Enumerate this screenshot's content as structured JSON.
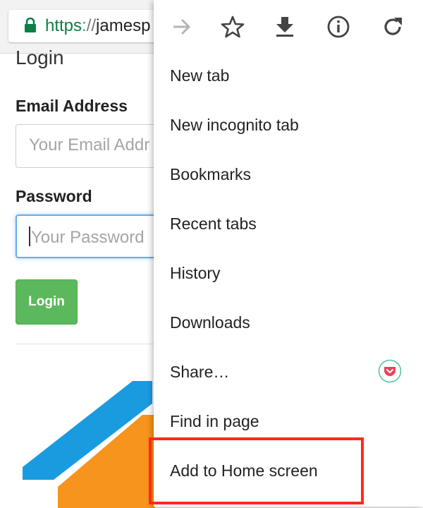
{
  "browser": {
    "url_scheme": "https",
    "url_separator": "://",
    "url_host": "jamesp",
    "icons": [
      "lock-icon",
      "forward-icon",
      "bookmark-star-icon",
      "download-icon",
      "info-icon",
      "reload-icon"
    ]
  },
  "page": {
    "title": "Login",
    "email_label": "Email Address",
    "email_placeholder": "Your Email Addr",
    "password_label": "Password",
    "password_placeholder": "Your Password",
    "login_button": "Login"
  },
  "menu": {
    "items": [
      {
        "label": "New tab"
      },
      {
        "label": "New incognito tab"
      },
      {
        "label": "Bookmarks"
      },
      {
        "label": "Recent tabs"
      },
      {
        "label": "History"
      },
      {
        "label": "Downloads"
      },
      {
        "label": "Share…",
        "icon": "pocket-icon"
      },
      {
        "label": "Find in page"
      },
      {
        "label": "Add to Home screen",
        "highlighted": true
      }
    ]
  },
  "colors": {
    "url_scheme": "#0b8043",
    "login_button": "#5cb85c",
    "highlight_border": "#ff2a16",
    "logo_blue": "#1a9be0",
    "logo_orange": "#f7941d"
  }
}
